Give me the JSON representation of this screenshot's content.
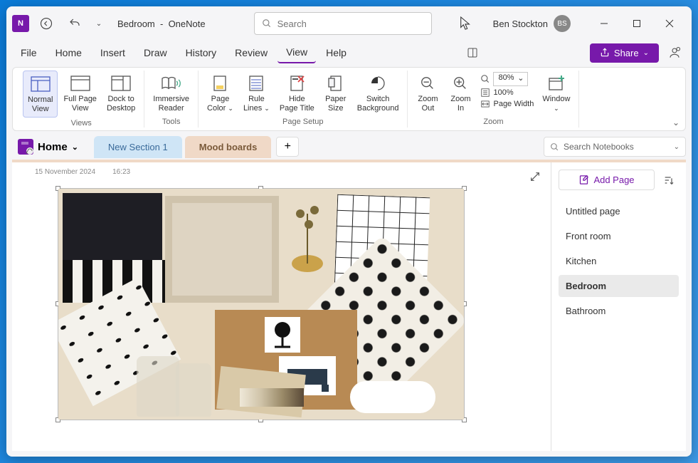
{
  "titlebar": {
    "page_title": "Bedroom",
    "app_name": "OneNote",
    "separator": "-",
    "search_placeholder": "Search",
    "user_name": "Ben Stockton",
    "user_initials": "BS"
  },
  "menu": {
    "items": [
      "File",
      "Home",
      "Insert",
      "Draw",
      "History",
      "Review",
      "View",
      "Help"
    ],
    "active_index": 6,
    "share_label": "Share"
  },
  "ribbon": {
    "views": {
      "label": "Views",
      "buttons": [
        {
          "label": "Normal\nView",
          "selected": true
        },
        {
          "label": "Full Page\nView"
        },
        {
          "label": "Dock to\nDesktop"
        }
      ]
    },
    "tools": {
      "label": "Tools",
      "buttons": [
        {
          "label": "Immersive\nReader"
        }
      ]
    },
    "page_setup": {
      "label": "Page Setup",
      "buttons": [
        {
          "label": "Page\nColor",
          "dropdown": true
        },
        {
          "label": "Rule\nLines",
          "dropdown": true
        },
        {
          "label": "Hide\nPage Title"
        },
        {
          "label": "Paper\nSize"
        },
        {
          "label": "Switch\nBackground"
        }
      ]
    },
    "zoom": {
      "label": "Zoom",
      "zoom_out": "Zoom\nOut",
      "zoom_in": "Zoom\nIn",
      "percent": "80%",
      "hundred": "100%",
      "page_width": "Page Width",
      "window": "Window"
    }
  },
  "sections": {
    "notebook": "Home",
    "tabs": [
      {
        "label": "New Section 1"
      },
      {
        "label": "Mood boards",
        "active": true
      }
    ],
    "search_placeholder": "Search Notebooks"
  },
  "canvas": {
    "date": "15 November 2024",
    "time": "16:23"
  },
  "pages": {
    "add_label": "Add Page",
    "items": [
      {
        "label": "Untitled page"
      },
      {
        "label": "Front room"
      },
      {
        "label": "Kitchen"
      },
      {
        "label": "Bedroom",
        "selected": true
      },
      {
        "label": "Bathroom"
      }
    ]
  }
}
